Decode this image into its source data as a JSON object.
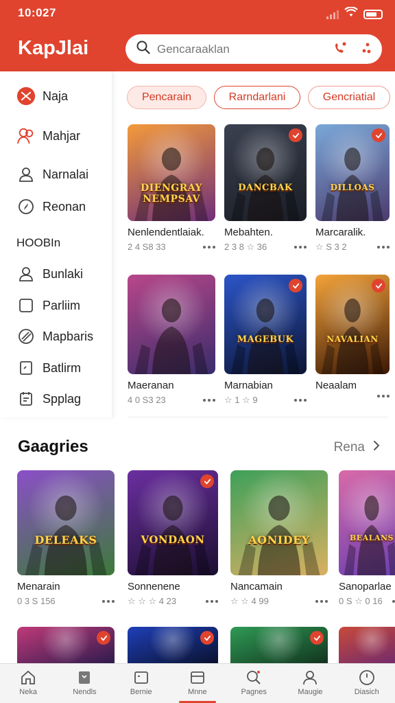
{
  "status": {
    "time": "10:027"
  },
  "header": {
    "app_title": "KapJlai",
    "search_placeholder": "Gencaraaklan"
  },
  "sidebar": {
    "items_top": [
      {
        "label": "Naja",
        "icon": "close-circle-icon"
      },
      {
        "label": "Mahjar",
        "icon": "people-icon"
      },
      {
        "label": "Narnalai",
        "icon": "user-icon"
      },
      {
        "label": "Reonan",
        "icon": "compass-icon"
      }
    ],
    "heading": "HOOBIn",
    "items_bottom": [
      {
        "label": "Bunlaki",
        "icon": "user-icon"
      },
      {
        "label": "Parliim",
        "icon": "square-icon"
      },
      {
        "label": "Mapbaris",
        "icon": "globe-icon"
      },
      {
        "label": "Batlirm",
        "icon": "document-icon"
      },
      {
        "label": "Spplag",
        "icon": "calendar-icon"
      }
    ]
  },
  "chips": [
    {
      "label": "Pencarain",
      "active": true
    },
    {
      "label": "Rarndarlani",
      "active": false
    },
    {
      "label": "Gencriatial",
      "active": false
    }
  ],
  "grid": [
    {
      "name": "Nenlendentlaiak.",
      "meta": "2 4 S8 33",
      "art_title": "DIENGRAY NEMPSAV",
      "badge": false,
      "colors": [
        "#f39a3b",
        "#6e2f7a"
      ]
    },
    {
      "name": "Mebahten.",
      "meta": "2 3 8 ☆ 36",
      "art_title": "DANCBAK",
      "badge": true,
      "colors": [
        "#3a4150",
        "#1a1d26"
      ]
    },
    {
      "name": "Marcaralik.",
      "meta": "☆ S 3 2",
      "art_title": "DILLOAS",
      "badge": true,
      "colors": [
        "#7aa8d8",
        "#4b3b6e"
      ]
    },
    {
      "name": "Maeranan",
      "meta": "4 0 S3 23",
      "art_title": "",
      "badge": false,
      "colors": [
        "#b8478a",
        "#3a2c6b"
      ]
    },
    {
      "name": "Marnabian",
      "meta": "☆ 1 ☆ 9",
      "art_title": "MAGEBUK",
      "badge": true,
      "colors": [
        "#2c55c8",
        "#0c1533"
      ]
    },
    {
      "name": "Neaalam",
      "meta": "",
      "art_title": "NAVALIAN",
      "badge": true,
      "colors": [
        "#f3a33a",
        "#3b1705"
      ]
    }
  ],
  "section": {
    "title": "Gaagries",
    "see_all": "Rena"
  },
  "row": [
    {
      "name": "Menarain",
      "meta": "0 3 S 156",
      "art_title": "DELEAKS",
      "badge": false,
      "colors": [
        "#8b4fc8",
        "#3d7a3a"
      ]
    },
    {
      "name": "Sonnenene",
      "meta": "☆ ☆ ☆ 4 23",
      "art_title": "VONDAON",
      "badge": true,
      "colors": [
        "#6b2fa0",
        "#1b0e30"
      ]
    },
    {
      "name": "Nancamain",
      "meta": "☆ ☆ 4 99",
      "art_title": "AONIDEY",
      "badge": false,
      "colors": [
        "#3ea05a",
        "#d9b062"
      ]
    },
    {
      "name": "Sanoparlae",
      "meta": "0 S ☆ 0 16",
      "art_title": "BEALANS",
      "badge": false,
      "colors": [
        "#d86aa8",
        "#6b3fb0"
      ]
    }
  ],
  "bottom_row_colors": [
    [
      "#c03a7a",
      "#2e1b4d"
    ],
    [
      "#1f3fb8",
      "#0a1230"
    ],
    [
      "#2f9a55",
      "#12351f"
    ],
    [
      "#c84a3a",
      "#6e2a6e"
    ]
  ],
  "nav": [
    {
      "label": "Neka",
      "icon": "home-icon"
    },
    {
      "label": "Nendls",
      "icon": "gamepad-icon"
    },
    {
      "label": "Bernie",
      "icon": "tv-icon"
    },
    {
      "label": "Mnne",
      "icon": "window-icon",
      "active": true
    },
    {
      "label": "Pagnes",
      "icon": "search-icon"
    },
    {
      "label": "Maugie",
      "icon": "person-icon"
    },
    {
      "label": "Diasich",
      "icon": "clock-icon"
    }
  ],
  "colors": {
    "accent": "#e0442f",
    "chip_fill": "#fdeae6"
  }
}
